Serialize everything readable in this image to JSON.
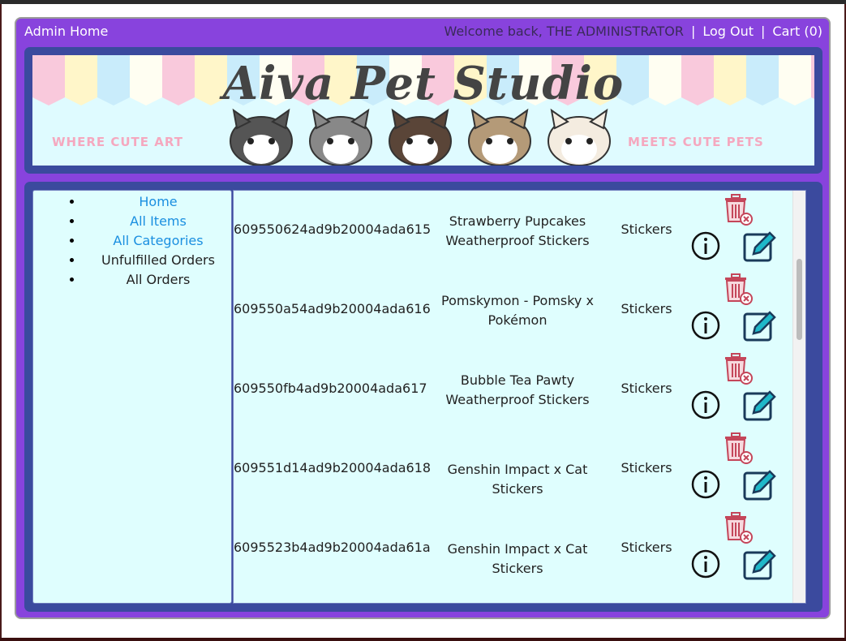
{
  "header": {
    "admin_home": "Admin Home",
    "welcome": "Welcome back, THE ADMINISTRATOR",
    "sep": "|",
    "logout": "Log Out",
    "cart": "Cart (0)"
  },
  "banner": {
    "title": "Aiva Pet Studio",
    "tagline_left": "WHERE CUTE ART",
    "tagline_right": "MEETS CUTE PETS"
  },
  "sidebar": {
    "items": [
      {
        "label": "Home",
        "link": true
      },
      {
        "label": "All Items",
        "link": true
      },
      {
        "label": "All Categories",
        "link": true
      },
      {
        "label": "Unfulfilled Orders",
        "link": false
      },
      {
        "label": "All Orders",
        "link": false
      }
    ]
  },
  "rows": [
    {
      "id": "609550624ad9b20004ada615",
      "name_line1": "Strawberry Pupcakes",
      "name_line2": "Weatherproof Stickers",
      "category": "Stickers"
    },
    {
      "id": "609550a54ad9b20004ada616",
      "name_line1": "Pomskymon - Pomsky x",
      "name_line2": "Pokémon",
      "category": "Stickers"
    },
    {
      "id": "609550fb4ad9b20004ada617",
      "name_line1": "Bubble Tea Pawty",
      "name_line2": "Weatherproof Stickers",
      "category": "Stickers"
    },
    {
      "id": "609551d14ad9b20004ada618",
      "name_line1": "Genshin Impact x Cat Stickers",
      "name_line2": "",
      "category": "Stickers"
    },
    {
      "id": "6095523b4ad9b20004ada61a",
      "name_line1": "Genshin Impact x Cat Stickers",
      "name_line2": "",
      "category": "Stickers"
    }
  ],
  "icons": {
    "trash": "trash-icon",
    "info": "info-icon",
    "edit": "edit-icon"
  },
  "colors": {
    "frame": "#8843dd",
    "panel": "#3b4a9e",
    "content_bg": "#dffefe",
    "link": "#1a8fe0",
    "trash": "#c4465a",
    "edit": "#1fb8c9"
  }
}
